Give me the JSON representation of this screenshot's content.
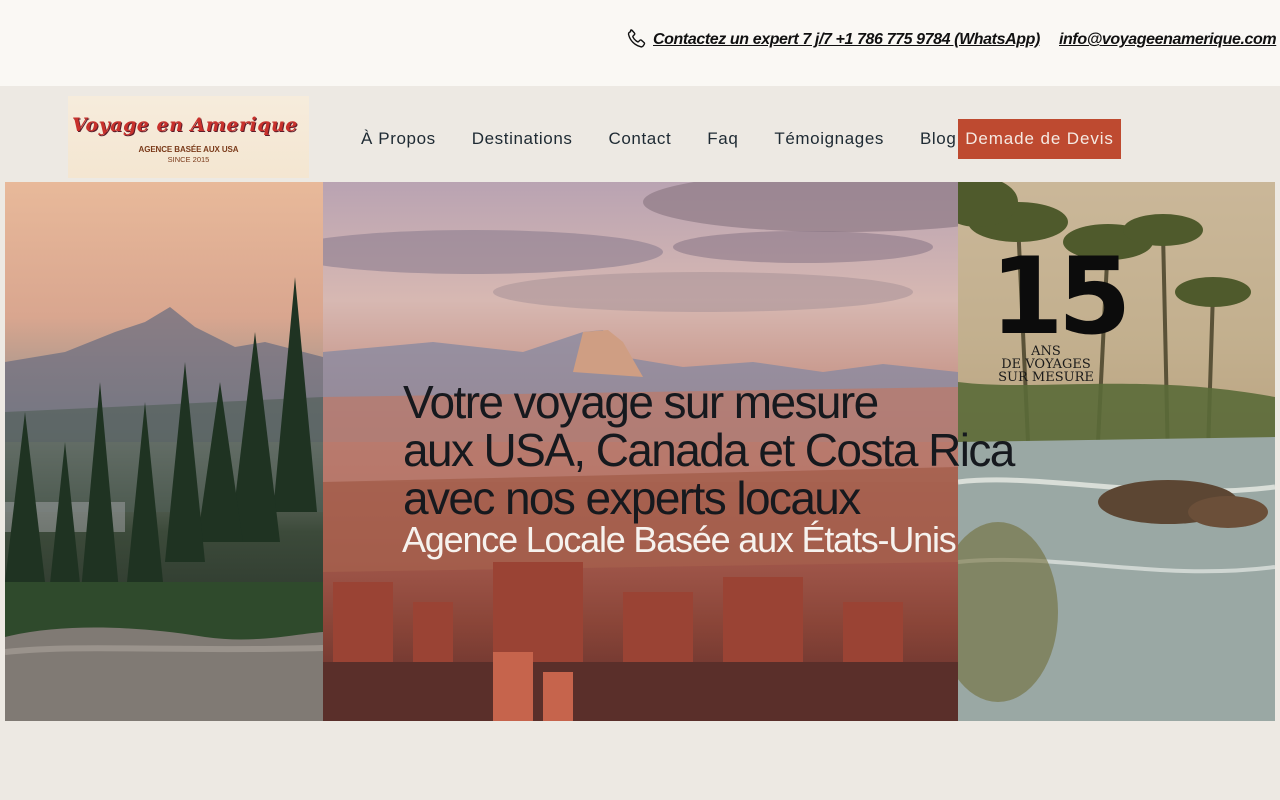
{
  "topbar": {
    "phone_icon": "phone-icon",
    "contact_text": "Contactez un expert 7 j/7 +1 786 775 9784 (WhatsApp)",
    "email": "info@voyageenamerique.com"
  },
  "logo": {
    "title": "Voyage en Amerique",
    "subtitle": "AGENCE BASÉE AUX USA",
    "since": "SINCE 2015"
  },
  "nav": {
    "items": [
      {
        "label": "À Propos"
      },
      {
        "label": "Destinations"
      },
      {
        "label": "Contact"
      },
      {
        "label": "Faq"
      },
      {
        "label": "Témoignages"
      },
      {
        "label": "Blog"
      }
    ],
    "cta_label": "Demade de Devis"
  },
  "hero": {
    "title_lines": [
      "Votre voyage sur mesure",
      "aux USA, Canada et Costa Rica",
      "avec nos experts locaux"
    ],
    "subtitle": "Agence Locale Basée aux États-Unis",
    "badge": {
      "number": "15",
      "lines": [
        "ANS",
        "DE VOYAGES",
        "SUR MESURE"
      ]
    }
  },
  "colors": {
    "background": "#ede9e3",
    "topbar_bg": "#faf8f4",
    "cta_bg": "#be4a30",
    "nav_text": "#1e2a33"
  }
}
